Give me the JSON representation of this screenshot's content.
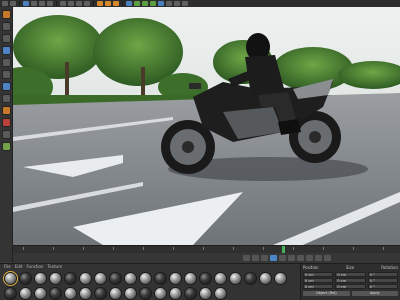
{
  "toolbar": {
    "buttons": [
      "undo-icon",
      "redo-icon",
      "select-icon",
      "move-icon",
      "scale-icon",
      "rotate-icon",
      "x-axis-icon",
      "y-axis-icon",
      "z-axis-icon",
      "world-coord-icon",
      "render-view-icon",
      "render-region-icon",
      "render-settings-icon",
      "cube-icon",
      "pen-icon",
      "subdivision-icon",
      "array-icon",
      "deformer-icon",
      "floor-icon",
      "camera-icon",
      "light-icon"
    ]
  },
  "lefttools": {
    "buttons": [
      "make-editable-icon",
      "model-mode-icon",
      "texture-mode-icon",
      "workplane-icon",
      "points-mode-icon",
      "edges-mode-icon",
      "polygons-mode-icon",
      "enable-axis-icon",
      "tweak-icon",
      "snap-icon",
      "workplane-lock-icon",
      "solo-icon"
    ]
  },
  "material_manager": {
    "menu": [
      "File",
      "Edit",
      "Function",
      "Texture"
    ],
    "material_count": 34
  },
  "attributes": {
    "header_left": "Position",
    "header_mid": "Size",
    "header_right": "Rotation",
    "rows": [
      [
        "0 cm",
        "0 cm",
        "0 °"
      ],
      [
        "0 cm",
        "0 cm",
        "0 °"
      ],
      [
        "0 cm",
        "0 cm",
        "0 °"
      ]
    ],
    "mode": "Object (Rel)",
    "apply_label": "Apply"
  },
  "colors": {
    "accent": "#4b86c8",
    "playhead": "#47b05a",
    "selection": "#e0b040"
  }
}
